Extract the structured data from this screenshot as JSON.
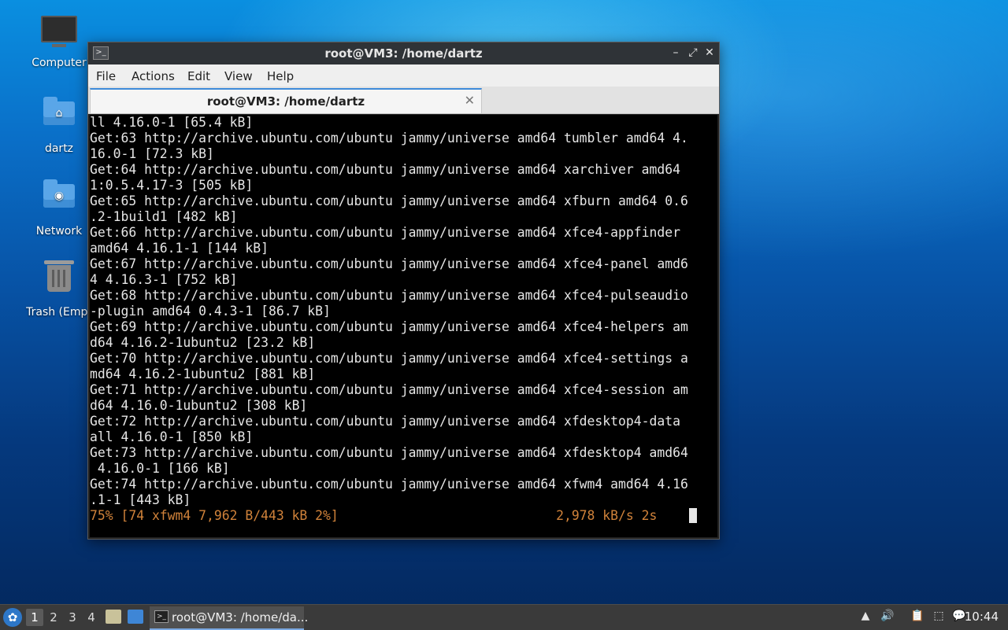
{
  "desktop": {
    "icons": [
      {
        "label": "Computer"
      },
      {
        "label": "dartz"
      },
      {
        "label": "Network"
      },
      {
        "label": "Trash (Empt"
      }
    ]
  },
  "window": {
    "title": "root@VM3: /home/dartz",
    "menu": [
      "File",
      "Actions",
      "Edit",
      "View",
      "Help"
    ],
    "tab_label": "root@VM3: /home/dartz",
    "terminal_lines": [
      "ll 4.16.0-1 [65.4 kB]",
      "Get:63 http://archive.ubuntu.com/ubuntu jammy/universe amd64 tumbler amd64 4.",
      "16.0-1 [72.3 kB]",
      "Get:64 http://archive.ubuntu.com/ubuntu jammy/universe amd64 xarchiver amd64",
      "1:0.5.4.17-3 [505 kB]",
      "Get:65 http://archive.ubuntu.com/ubuntu jammy/universe amd64 xfburn amd64 0.6",
      ".2-1build1 [482 kB]",
      "Get:66 http://archive.ubuntu.com/ubuntu jammy/universe amd64 xfce4-appfinder",
      "amd64 4.16.1-1 [144 kB]",
      "Get:67 http://archive.ubuntu.com/ubuntu jammy/universe amd64 xfce4-panel amd6",
      "4 4.16.3-1 [752 kB]",
      "Get:68 http://archive.ubuntu.com/ubuntu jammy/universe amd64 xfce4-pulseaudio",
      "-plugin amd64 0.4.3-1 [86.7 kB]",
      "Get:69 http://archive.ubuntu.com/ubuntu jammy/universe amd64 xfce4-helpers am",
      "d64 4.16.2-1ubuntu2 [23.2 kB]",
      "Get:70 http://archive.ubuntu.com/ubuntu jammy/universe amd64 xfce4-settings a",
      "md64 4.16.2-1ubuntu2 [881 kB]",
      "Get:71 http://archive.ubuntu.com/ubuntu jammy/universe amd64 xfce4-session am",
      "d64 4.16.0-1ubuntu2 [308 kB]",
      "Get:72 http://archive.ubuntu.com/ubuntu jammy/universe amd64 xfdesktop4-data",
      "all 4.16.0-1 [850 kB]",
      "Get:73 http://archive.ubuntu.com/ubuntu jammy/universe amd64 xfdesktop4 amd64",
      " 4.16.0-1 [166 kB]",
      "Get:74 http://archive.ubuntu.com/ubuntu jammy/universe amd64 xfwm4 amd64 4.16",
      ".1-1 [443 kB]"
    ],
    "progress_line": "75% [74 xfwm4 7,962 B/443 kB 2%]                            2,978 kB/s 2s"
  },
  "taskbar": {
    "workspaces": [
      "1",
      "2",
      "3",
      "4"
    ],
    "task_label": "root@VM3: /home/da...",
    "clock": "10:44"
  },
  "icons": {
    "menu": "whisker-menu-icon",
    "terminal": "terminal-icon",
    "volume": "volume-icon",
    "network": "network-icon",
    "clipboard": "clipboard-icon",
    "updates": "updates-icon"
  }
}
